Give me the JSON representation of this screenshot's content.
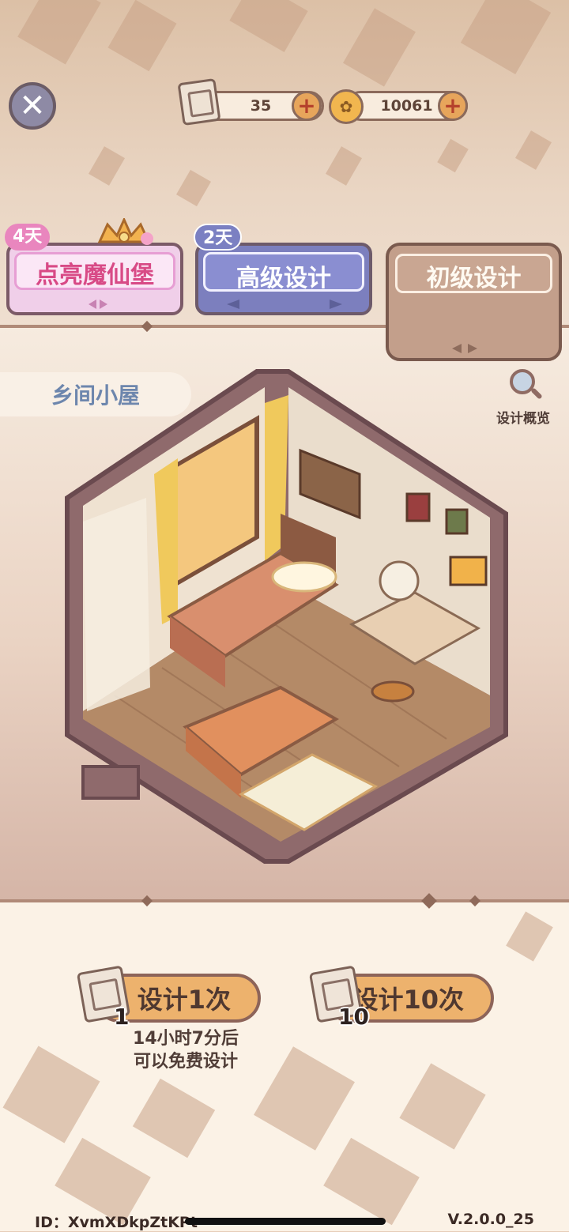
{
  "currency": {
    "scrolls": "35",
    "coins": "10061",
    "scroll_icon": "design-scroll-icon",
    "coin_icon": "gold-coin-icon",
    "add_icon": "plus-icon"
  },
  "tabs": [
    {
      "label": "点亮魔仙堡",
      "badge": "4天"
    },
    {
      "label": "高级设计",
      "badge": "2天"
    },
    {
      "label": "初级设计"
    }
  ],
  "room": {
    "name": "乡间小屋",
    "overview_label": "设计概览"
  },
  "actions": {
    "single": {
      "label": "设计1次",
      "cost": "1"
    },
    "ten": {
      "label": "设计10次",
      "cost": "10"
    },
    "free_hint_line1": "14小时7分后",
    "free_hint_line2": "可以免费设计"
  },
  "footer": {
    "id": "ID：XvmXDkpZtKPt",
    "version": "V.2.0.0_25"
  },
  "colors": {
    "castle_tab": "#f0cfe9",
    "advanced_tab": "#7c7fbe",
    "basic_tab": "#c39f8b",
    "button": "#edb26d"
  }
}
